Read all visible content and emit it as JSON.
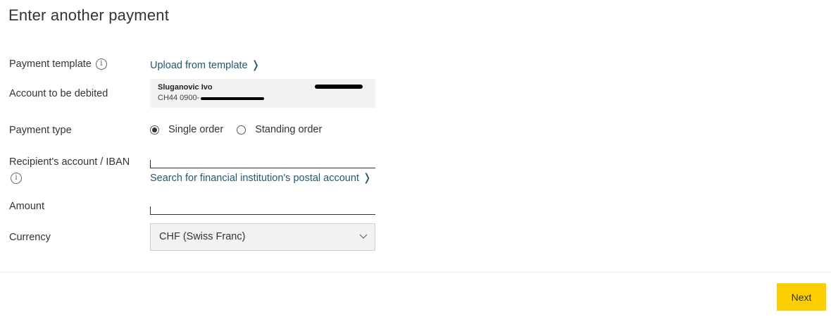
{
  "page": {
    "title": "Enter another payment"
  },
  "form": {
    "payment_template": {
      "label": "Payment template",
      "info_icon": "i",
      "link": "Upload from template",
      "link_icon": "chevron-right-icon"
    },
    "account_debited": {
      "label": "Account to be debited",
      "name": "Sluganovic Ivo",
      "iban": "CH44 0900-"
    },
    "payment_type": {
      "label": "Payment type",
      "options": [
        {
          "label": "Single order",
          "selected": true
        },
        {
          "label": "Standing order",
          "selected": false
        }
      ]
    },
    "recipient": {
      "label": "Recipient's account / IBAN",
      "info_icon": "i",
      "value": "",
      "link": "Search for financial institution's postal account"
    },
    "amount": {
      "label": "Amount",
      "value": ""
    },
    "currency": {
      "label": "Currency",
      "selected": "CHF (Swiss Franc)",
      "icon": "chevron-down-icon"
    }
  },
  "footer": {
    "next_label": "Next"
  },
  "colors": {
    "accent": "#fccf00",
    "link": "#1f5a73"
  }
}
